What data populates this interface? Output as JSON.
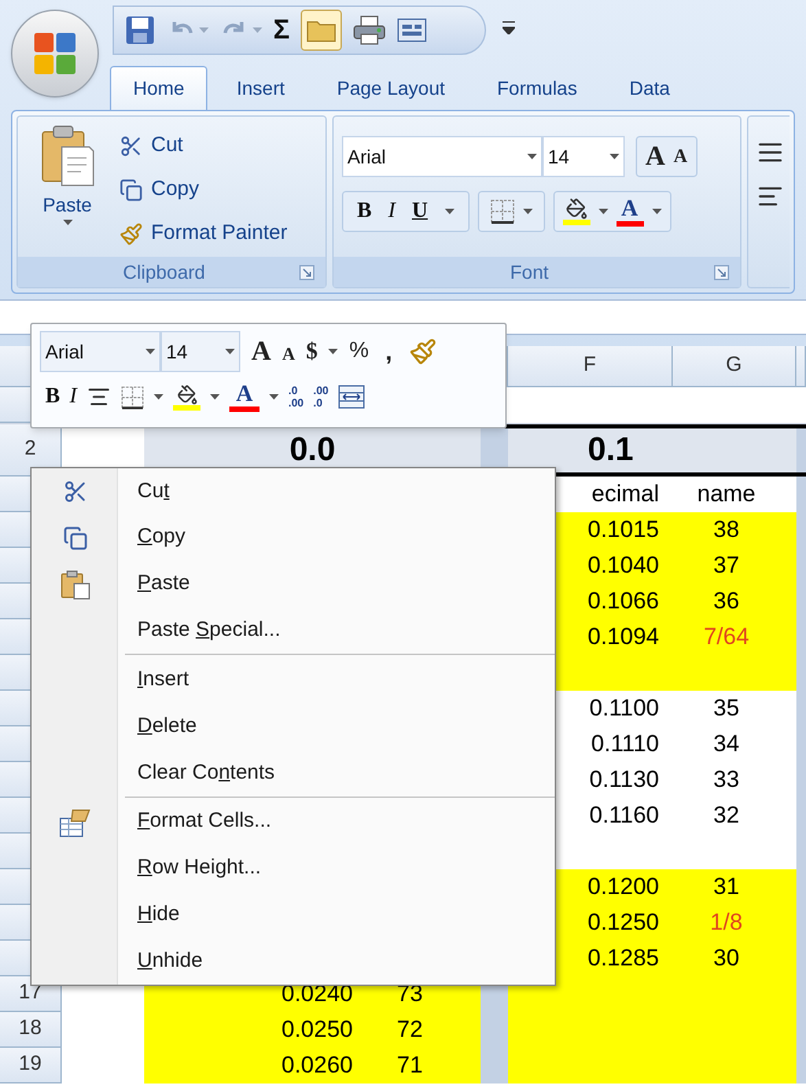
{
  "quick_access": {
    "sum": "Σ"
  },
  "ribbon": {
    "tabs": [
      {
        "label": "Home",
        "selected": true
      },
      {
        "label": "Insert",
        "selected": false
      },
      {
        "label": "Page Layout",
        "selected": false
      },
      {
        "label": "Formulas",
        "selected": false
      },
      {
        "label": "Data",
        "selected": false
      }
    ],
    "clipboard": {
      "paste": "Paste",
      "cut": "Cut",
      "copy": "Copy",
      "format_painter": "Format Painter",
      "label": "Clipboard"
    },
    "font": {
      "font_name": "Arial",
      "font_size": "14",
      "grow": "A",
      "shrink": "A",
      "bold": "B",
      "italic": "I",
      "underline": "U",
      "font_color": "A",
      "label": "Font"
    }
  },
  "mini_toolbar": {
    "font_name": "Arial",
    "font_size": "14",
    "grow": "A",
    "shrink": "A",
    "currency": "$",
    "percent": "%",
    "comma": ",",
    "bold": "B",
    "italic": "I",
    "font_color": "A",
    "increase_decimal": [
      ".0",
      ".00"
    ],
    "decrease_decimal": [
      ".00",
      ".0"
    ]
  },
  "sheet": {
    "column_headers": [
      "F",
      "G"
    ],
    "row_2": {
      "row_number": "2",
      "cells": [
        "0.0",
        "0.1"
      ]
    },
    "rows": [
      {
        "right": {
          "decimal": "ecimal",
          "name": "name",
          "color": "#000000"
        },
        "right_highlighted": false
      },
      {
        "right": {
          "decimal": "0.1015",
          "name": "38",
          "color": "#000000"
        },
        "right_highlighted": true
      },
      {
        "right": {
          "decimal": "0.1040",
          "name": "37",
          "color": "#000000"
        },
        "right_highlighted": true
      },
      {
        "right": {
          "decimal": "0.1066",
          "name": "36",
          "color": "#000000"
        },
        "right_highlighted": true
      },
      {
        "right": {
          "decimal": "0.1094",
          "name": "7/64",
          "color": "#e0461e"
        },
        "right_highlighted": true
      },
      {
        "right_highlighted": true
      },
      {
        "right": {
          "decimal": "0.1100",
          "name": "35",
          "color": "#000000"
        },
        "right_highlighted": false
      },
      {
        "right": {
          "decimal": "0.1110",
          "name": "34",
          "color": "#000000"
        },
        "right_highlighted": false
      },
      {
        "right": {
          "decimal": "0.1130",
          "name": "33",
          "color": "#000000"
        },
        "right_highlighted": false
      },
      {
        "right": {
          "decimal": "0.1160",
          "name": "32",
          "color": "#000000"
        },
        "right_highlighted": false
      },
      {
        "right_highlighted": false
      },
      {
        "right": {
          "decimal": "0.1200",
          "name": "31",
          "color": "#000000"
        },
        "right_highlighted": true
      },
      {
        "right": {
          "decimal": "0.1250",
          "name": "1/8",
          "color": "#e0461e"
        },
        "right_highlighted": true
      },
      {
        "right": {
          "decimal": "0.1285",
          "name": "30",
          "color": "#000000"
        },
        "right_highlighted": true
      },
      {
        "row_number": "17",
        "left": {
          "decimal": "0.0240",
          "name": "73"
        },
        "left_highlighted": true,
        "right_highlighted": true
      },
      {
        "row_number": "18",
        "left": {
          "decimal": "0.0250",
          "name": "72"
        },
        "left_highlighted": true,
        "right_highlighted": true
      },
      {
        "row_number": "19",
        "left": {
          "decimal": "0.0260",
          "name": "71"
        },
        "left_highlighted": true,
        "right_highlighted": true
      }
    ]
  },
  "context_menu": {
    "items": [
      {
        "kind": "cut",
        "label": {
          "before": "Cu",
          "key": "t"
        }
      },
      {
        "kind": "copy",
        "label": {
          "key": "C",
          "after": "opy"
        }
      },
      {
        "kind": "paste",
        "label": {
          "key": "P",
          "after": "aste"
        }
      },
      {
        "kind": "plain",
        "label": {
          "before": "Paste ",
          "key": "S",
          "after": "pecial..."
        }
      },
      {
        "kind": "separator"
      },
      {
        "kind": "plain",
        "label": {
          "key": "I",
          "after": "nsert"
        }
      },
      {
        "kind": "plain",
        "label": {
          "key": "D",
          "after": "elete"
        }
      },
      {
        "kind": "plain",
        "label": {
          "before": "Clear Co",
          "key": "n",
          "after": "tents"
        }
      },
      {
        "kind": "separator"
      },
      {
        "kind": "format",
        "label": {
          "key": "F",
          "after": "ormat Cells..."
        }
      },
      {
        "kind": "plain",
        "label": {
          "key": "R",
          "after": "ow Height..."
        }
      },
      {
        "kind": "plain",
        "label": {
          "key": "H",
          "after": "ide"
        }
      },
      {
        "kind": "plain",
        "label": {
          "key": "U",
          "after": "nhide"
        }
      }
    ]
  }
}
